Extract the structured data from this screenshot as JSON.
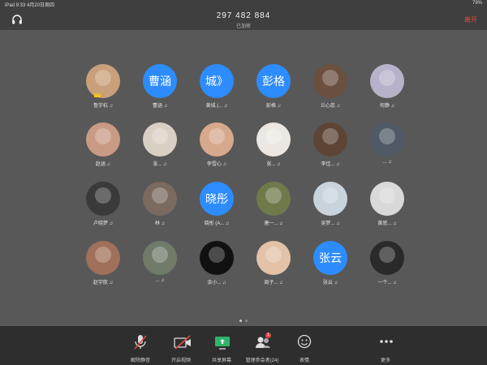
{
  "status": {
    "left": "iPad 9:33  4月20日周四",
    "right": "79%"
  },
  "header": {
    "meeting_id": "297 482 884",
    "subtitle": "已加密",
    "leave_label": "离开"
  },
  "participants": [
    {
      "name": "鲁宇杭 ♫",
      "avatar": "photo",
      "color": "#c9a07a",
      "host": true
    },
    {
      "name": "曹涵 ♫",
      "avatar": "text",
      "initials": "曹涵"
    },
    {
      "name": "黄城 (... ♫",
      "avatar": "text",
      "initials": "城》"
    },
    {
      "name": "彭格 ♫",
      "avatar": "text",
      "initials": "彭格"
    },
    {
      "name": "兰心蕊 ♫",
      "avatar": "photo",
      "color": "#6b4f3f"
    },
    {
      "name": "何静 ♫",
      "avatar": "photo",
      "color": "#b7b2c9"
    },
    {
      "name": "赵涵 ♫",
      "avatar": "photo",
      "color": "#c99a84"
    },
    {
      "name": "张... ♫",
      "avatar": "photo",
      "color": "#d8d0c4"
    },
    {
      "name": "李雪心 ♫",
      "avatar": "photo",
      "color": "#d7a98c"
    },
    {
      "name": "张... ♫",
      "avatar": "photo",
      "color": "#ece7e2"
    },
    {
      "name": "李佳... ♫",
      "avatar": "photo",
      "color": "#5d4536"
    },
    {
      "name": "... ♫",
      "avatar": "photo",
      "color": "#4f5a66"
    },
    {
      "name": "卢晓梦 ♫",
      "avatar": "photo",
      "color": "#3a3a3a"
    },
    {
      "name": "林 ♫",
      "avatar": "photo",
      "color": "#7a6a5f"
    },
    {
      "name": "晓彤 (A... ♫",
      "avatar": "text",
      "initials": "晓彤"
    },
    {
      "name": "唐一... ♫",
      "avatar": "photo",
      "color": "#6e7a4a"
    },
    {
      "name": "吴梦... ♫",
      "avatar": "photo",
      "color": "#c9d3dc"
    },
    {
      "name": "黄思... ♫",
      "avatar": "photo",
      "color": "#d9d9d9"
    },
    {
      "name": "赵宇航 ♫",
      "avatar": "photo",
      "color": "#a0705a"
    },
    {
      "name": "... ♫",
      "avatar": "photo",
      "color": "#707b6a"
    },
    {
      "name": "余小... ♫",
      "avatar": "photo",
      "color": "#111111"
    },
    {
      "name": "周子... ♫",
      "avatar": "photo",
      "color": "#e3c2a8"
    },
    {
      "name": "张云 ♫",
      "avatar": "text",
      "initials": "张云"
    },
    {
      "name": "一个... ♫",
      "avatar": "photo",
      "color": "#2a2a2a"
    }
  ],
  "toolbar": {
    "mute_label": "解除静音",
    "video_label": "开启视频",
    "share_label": "共享屏幕",
    "participants_label": "管理参会者(24)",
    "participants_badge": "1",
    "reactions_label": "表情",
    "more_label": "更多"
  },
  "colors": {
    "accent": "#2d8cff",
    "danger": "#e24a3d"
  }
}
